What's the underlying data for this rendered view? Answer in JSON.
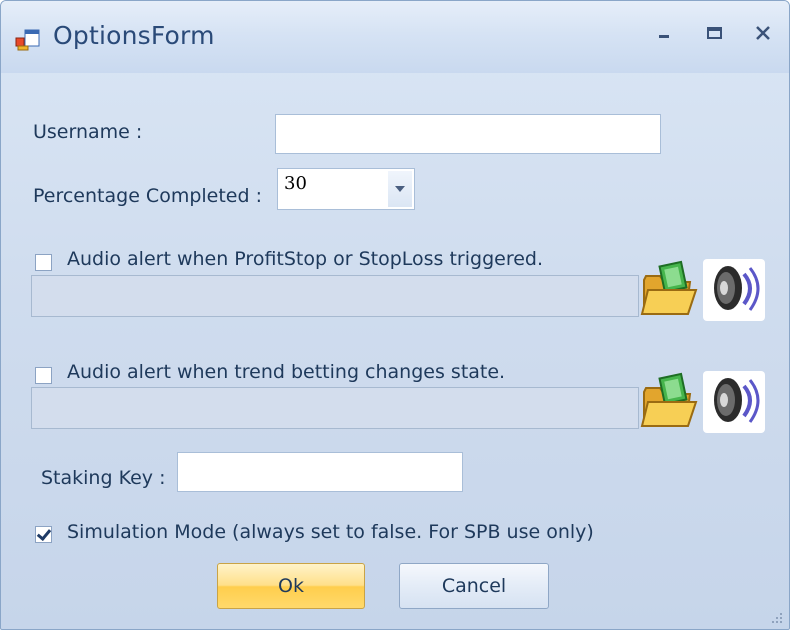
{
  "window": {
    "title": "OptionsForm",
    "controls": {
      "minimize": "minimize",
      "maximize": "maximize",
      "close": "close"
    }
  },
  "form": {
    "username_label": "Username :",
    "username_value": "",
    "percentage_label": "Percentage Completed :",
    "percentage_value": "30",
    "audio_alert_profit": {
      "label": "Audio alert when ProfitStop or StopLoss triggered.",
      "checked": false,
      "path_value": ""
    },
    "audio_alert_trend": {
      "label": "Audio alert when trend betting changes state.",
      "checked": false,
      "path_value": ""
    },
    "staking_key_label": "Staking Key :",
    "staking_key_value": "",
    "simulation_mode": {
      "label": "Simulation Mode (always set to false.  For SPB use only)",
      "checked": true
    }
  },
  "buttons": {
    "ok": "Ok",
    "cancel": "Cancel"
  },
  "icons": {
    "app": "app-form-icon",
    "browse": "folder-open-icon",
    "play": "speaker-icon"
  },
  "colors": {
    "window_bg": "#cfdcee",
    "label_text": "#1e395b",
    "title_text": "#2a4a78",
    "ok_button": "#ffd96b",
    "cancel_button": "#e4ecf7"
  }
}
